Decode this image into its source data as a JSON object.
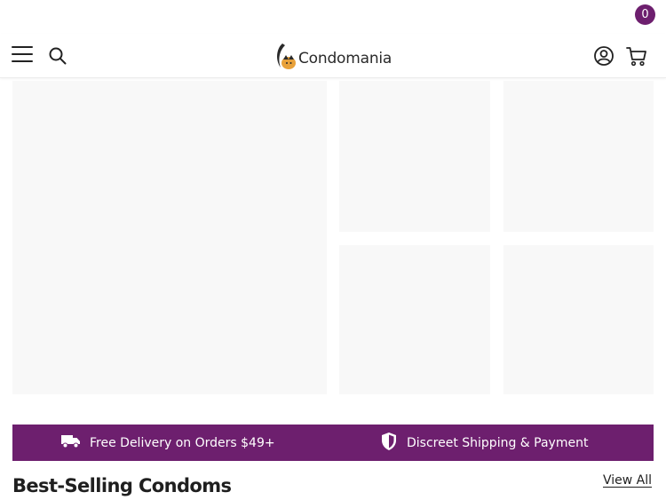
{
  "header": {
    "menu_icon": "hamburger-menu-icon",
    "search_icon": "search-icon",
    "logo_text": "Condomania",
    "account_icon": "account-icon",
    "cart_icon": "shopping-cart-icon",
    "cart_count": "0"
  },
  "promo": {
    "delivery_text": "Free Delivery on Orders $49+",
    "delivery_icon": "truck-icon",
    "discreet_text": "Discreet Shipping & Payment",
    "discreet_icon": "shield-icon"
  },
  "section": {
    "title": "Best-Selling Condoms",
    "view_all": "View All"
  },
  "colors": {
    "brand_purple": "#6d1f6e",
    "placeholder_bg": "#f8f8f8",
    "logo_orange": "#e8a13a"
  }
}
